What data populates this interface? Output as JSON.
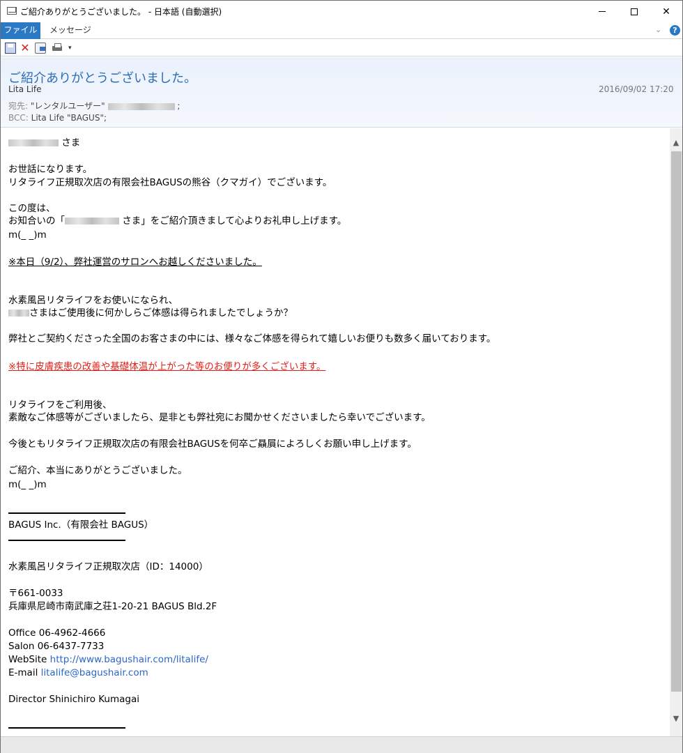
{
  "window": {
    "title": "ご紹介ありがとうございました。 - 日本語 (自動選択)",
    "minimize": "—",
    "close": "✕"
  },
  "ribbon": {
    "tab_file": "ファイル",
    "tab_message": "メッセージ",
    "collapse": "⌄",
    "help": "?"
  },
  "toolbar": {
    "delete": "✕",
    "more": "▾"
  },
  "header": {
    "subject": "ご紹介ありがとうございました。",
    "from": "Lita Life",
    "date": "2016/09/02 17:20",
    "to_label": "宛先:",
    "to_value": "\"レンタルユーザー\"",
    "to_suffix": ";",
    "bcc_label": "BCC:",
    "bcc_value": "Lita Life \"BAGUS\";"
  },
  "body": {
    "salutation": "さま",
    "l1": "お世話になります。",
    "l2": "リタライフ正規取次店の有限会社BAGUSの熊谷（クマガイ）でございます。",
    "l3": "この度は、",
    "l4a": "お知合いの「",
    "l4b": " さま」をご紹介頂きまして心よりお礼申し上げます。",
    "l5": "m(_ _)m",
    "l6": "※本日（9/2）、弊社運営のサロンへお越しくださいました。",
    "l7": "水素風呂リタライフをお使いになられ、",
    "l8": "さまはご使用後に何かしらご体感は得られましたでしょうか？",
    "l9": "弊社とご契約くださった全国のお客さまの中には、様々なご体感を得られて嬉しいお便りも数多く届いております。",
    "l10": "※特に皮膚疾患の改善や基礎体温が上がった等のお便りが多くございます。",
    "l11": "リタライフをご利用後、",
    "l12": "素敵なご体感等がございましたら、是非とも弊社宛にお聞かせくださいましたら幸いでございます。",
    "l13": "今後ともリタライフ正規取次店の有限会社BAGUSを何卒ご贔屓によろしくお願い申し上げます。",
    "l14": "ご紹介、本当にありがとうございました。",
    "l15": "m(_ _)m",
    "sig_company": "BAGUS Inc.（有限会社 BAGUS）",
    "sig_store": "水素風呂リタライフ正規取次店（ID：14000）",
    "sig_zip": "〒661-0033",
    "sig_address": "兵庫県尼崎市南武庫之荘1-20-21 BAGUS Bld.2F",
    "sig_office": "Office   06-4962-4666",
    "sig_salon": "Salon   06-6437-7733",
    "sig_web_label": "WebSite  ",
    "sig_web_url": "http://www.bagushair.com/litalife/",
    "sig_email_label": "E-mail   ",
    "sig_email": "litalife@bagushair.com",
    "sig_director": "Director Shinichiro Kumagai"
  },
  "scrollbar": {
    "up": "▲",
    "down": "▼"
  }
}
